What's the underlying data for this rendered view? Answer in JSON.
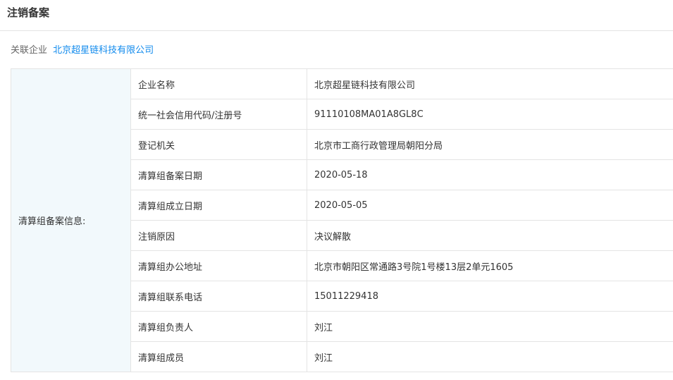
{
  "header": {
    "title": "注销备案"
  },
  "related": {
    "label": "关联企业",
    "company_link": "北京超星链科技有限公司"
  },
  "record": {
    "group_label": "清算组备案信息:",
    "rows": [
      {
        "label": "企业名称",
        "value": "北京超星链科技有限公司"
      },
      {
        "label": "统一社会信用代码/注册号",
        "value": "91110108MA01A8GL8C"
      },
      {
        "label": "登记机关",
        "value": "北京市工商行政管理局朝阳分局"
      },
      {
        "label": "清算组备案日期",
        "value": "2020-05-18"
      },
      {
        "label": "清算组成立日期",
        "value": "2020-05-05"
      },
      {
        "label": "注销原因",
        "value": "决议解散"
      },
      {
        "label": "清算组办公地址",
        "value": "北京市朝阳区常通路3号院1号楼13层2单元1605"
      },
      {
        "label": "清算组联系电话",
        "value": "15011229418"
      },
      {
        "label": "清算组负责人",
        "value": "刘江"
      },
      {
        "label": "清算组成员",
        "value": "刘江"
      }
    ]
  },
  "colors": {
    "link": "#128bed",
    "label_bg": "#f2f9fc",
    "border": "#e4e4e4"
  }
}
